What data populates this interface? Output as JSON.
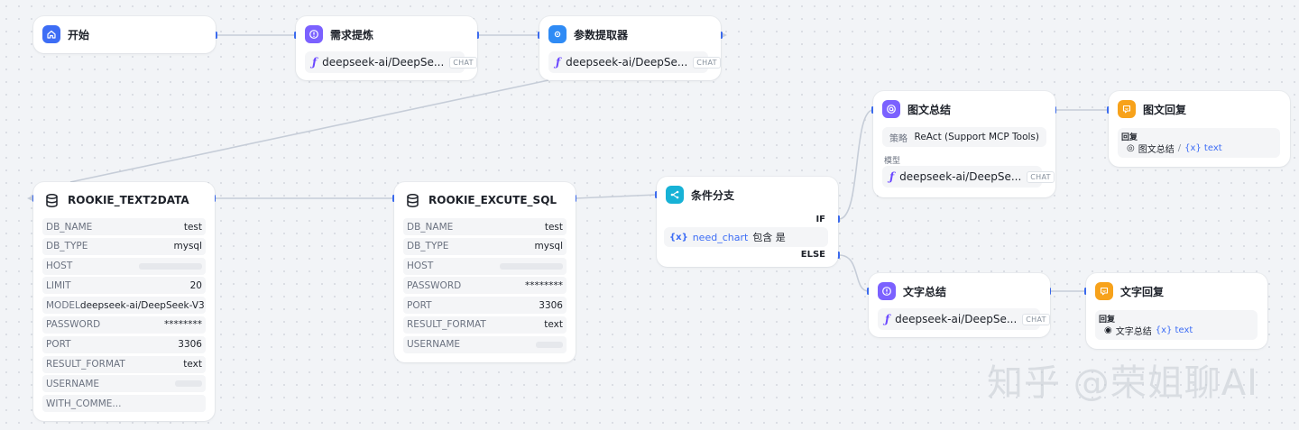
{
  "nodes": {
    "start": {
      "title": "开始"
    },
    "requirement": {
      "title": "需求提炼",
      "model": "deepseek-ai/DeepSe...",
      "model_tag": "CHAT"
    },
    "param": {
      "title": "参数提取器",
      "model": "deepseek-ai/DeepSe...",
      "model_tag": "CHAT"
    },
    "text2data": {
      "title": "ROOKIE_TEXT2DATA",
      "rows": [
        {
          "key": "DB_NAME",
          "value": "test"
        },
        {
          "key": "DB_TYPE",
          "value": "mysql"
        },
        {
          "key": "HOST",
          "value": ""
        },
        {
          "key": "LIMIT",
          "value": "20"
        },
        {
          "key": "MODEL",
          "value": "deepseek-ai/DeepSeek-V3"
        },
        {
          "key": "PASSWORD",
          "value": "********"
        },
        {
          "key": "PORT",
          "value": "3306"
        },
        {
          "key": "RESULT_FORMAT",
          "value": "text"
        },
        {
          "key": "USERNAME",
          "value": ""
        },
        {
          "key": "WITH_COMME...",
          "value": ""
        }
      ]
    },
    "execute_sql": {
      "title": "ROOKIE_EXCUTE_SQL",
      "rows": [
        {
          "key": "DB_NAME",
          "value": "test"
        },
        {
          "key": "DB_TYPE",
          "value": "mysql"
        },
        {
          "key": "HOST",
          "value": ""
        },
        {
          "key": "PASSWORD",
          "value": "********"
        },
        {
          "key": "PORT",
          "value": "3306"
        },
        {
          "key": "RESULT_FORMAT",
          "value": "text"
        },
        {
          "key": "USERNAME",
          "value": ""
        }
      ]
    },
    "branch": {
      "title": "条件分支",
      "if_label": "IF",
      "else_label": "ELSE",
      "condition_var": "{x}",
      "condition_name": "need_chart",
      "condition_op": "包含 是"
    },
    "image_summary": {
      "title": "图文总结",
      "strategy_label": "策略",
      "strategy_value": "ReAct (Support MCP Tools)",
      "model_label": "模型",
      "model": "deepseek-ai/DeepSe...",
      "model_tag": "CHAT"
    },
    "image_reply": {
      "title": "图文回复",
      "reply_label": "回复",
      "ref_node": "图文总结",
      "separator": "/",
      "ref_var": "{x} text"
    },
    "text_summary": {
      "title": "文字总结",
      "model": "deepseek-ai/DeepSe...",
      "model_tag": "CHAT"
    },
    "text_reply": {
      "title": "文字回复",
      "reply_label": "回复",
      "ref_node": "文字总结",
      "ref_var": "{x} text"
    }
  },
  "watermark": "知乎 @荣姐聊AI",
  "colors": {
    "accent": "#3d6df5",
    "violet": "#7b61ff",
    "teal": "#17b2d6",
    "orange": "#f7a21b"
  }
}
